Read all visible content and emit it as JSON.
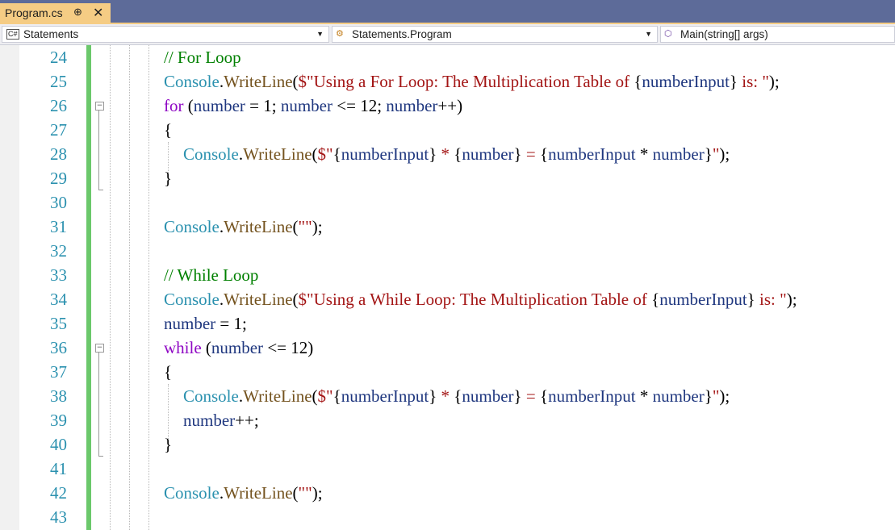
{
  "tab": {
    "title": "Program.cs",
    "pin_icon": "pin-icon",
    "close_icon": "close-icon",
    "pin_glyph": "⊕",
    "close_glyph": "✕"
  },
  "nav": {
    "project": "Statements",
    "project_icon": "C#",
    "class": "Statements.Program",
    "member": "Main(string[] args)"
  },
  "lines": [
    {
      "n": "24",
      "t": "// For Loop"
    },
    {
      "n": "25",
      "t": "Console.WriteLine($\"Using a For Loop: The Multiplication Table of {numberInput} is: \");"
    },
    {
      "n": "26",
      "t": "for (number = 1; number <= 12; number++)"
    },
    {
      "n": "27",
      "t": "{"
    },
    {
      "n": "28",
      "t": "Console.WriteLine($\"{numberInput} * {number} = {numberInput * number}\");"
    },
    {
      "n": "29",
      "t": "}"
    },
    {
      "n": "30",
      "t": ""
    },
    {
      "n": "31",
      "t": "Console.WriteLine(\"\");"
    },
    {
      "n": "32",
      "t": ""
    },
    {
      "n": "33",
      "t": "// While Loop"
    },
    {
      "n": "34",
      "t": "Console.WriteLine($\"Using a While Loop: The Multiplication Table of {numberInput} is: \");"
    },
    {
      "n": "35",
      "t": "number = 1;"
    },
    {
      "n": "36",
      "t": "while (number <= 12)"
    },
    {
      "n": "37",
      "t": "{"
    },
    {
      "n": "38",
      "t": "Console.WriteLine($\"{numberInput} * {number} = {numberInput * number}\");"
    },
    {
      "n": "39",
      "t": "number++;"
    },
    {
      "n": "40",
      "t": "}"
    },
    {
      "n": "41",
      "t": ""
    },
    {
      "n": "42",
      "t": "Console.WriteLine(\"\");"
    },
    {
      "n": "43",
      "t": ""
    }
  ],
  "colors": {
    "comment": "#008000",
    "type": "#2b91af",
    "method": "#74531f",
    "string": "#a31515",
    "identifier": "#1f377f",
    "keyword": "#8f08c4",
    "line_number": "#2b91af",
    "tab_active": "#f5cc84",
    "tab_bar": "#5d6b99",
    "changed_margin": "#6bc86b"
  }
}
